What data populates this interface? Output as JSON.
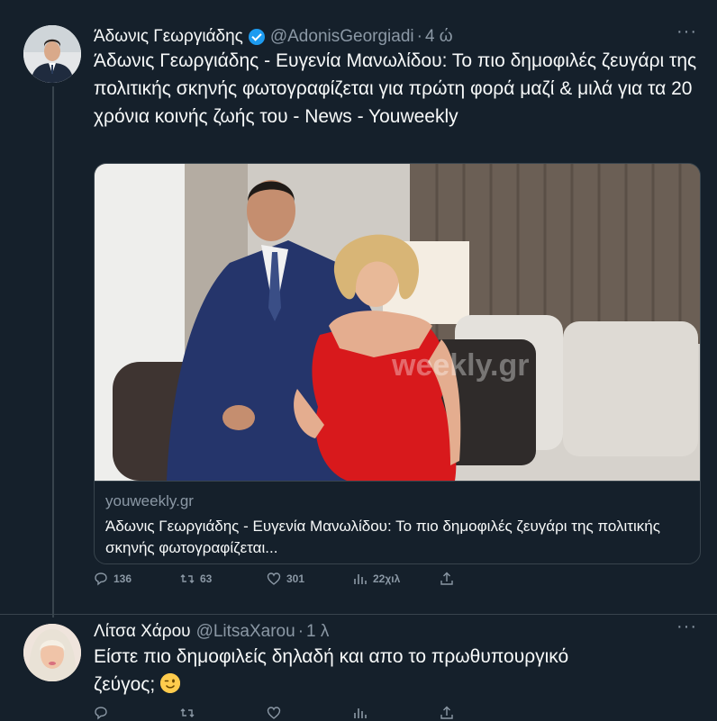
{
  "tweet1": {
    "name": "Άδωνις Γεωργιάδης",
    "handle": "@AdonisGeorgiadi",
    "separator": "·",
    "time": "4 ώ",
    "more": "···",
    "text": "Άδωνις Γεωργιάδης - Ευγενία Μανωλίδου: Το πιο δημοφιλές ζευγάρι της πολιτικής σκηνής φωτογραφίζεται για πρώτη φορά μαζί & μιλά για τα 20 χρόνια κοινής ζωής του - News - Youweekly",
    "card": {
      "watermark": "weekly.gr",
      "domain": "youweekly.gr",
      "title": "Άδωνις Γεωργιάδης - Ευγενία Μανωλίδου: Το πιο δημοφιλές ζευγάρι της πολιτικής σκηνής φωτογραφίζεται..."
    },
    "actions": {
      "reply_count": "136",
      "retweet_count": "63",
      "like_count": "301",
      "views_count": "22χιλ"
    }
  },
  "tweet2": {
    "name": "Λίτσα Χάρου",
    "handle": "@LitsaXarou",
    "separator": "·",
    "time": "1 λ",
    "more": "···",
    "text_line1": "Είστε πιο δημοφιλείς δηλαδή και απο το πρωθυπουργικό",
    "text_line2": "ζεύγος;",
    "emoji": "winking-face"
  },
  "colors": {
    "background": "#15202b",
    "text": "#f7f9f9",
    "secondary": "#8b98a5",
    "border": "#38444d",
    "accent": "#1d9bf0"
  }
}
